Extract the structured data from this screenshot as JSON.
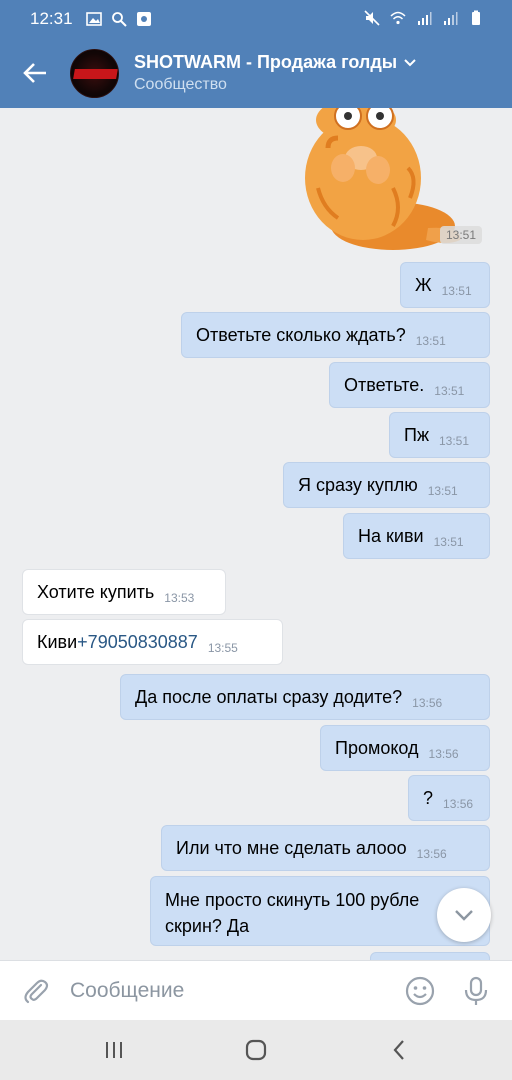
{
  "status_bar": {
    "time": "12:31"
  },
  "header": {
    "title": "SHOTWARM - Продажа голды",
    "subtitle": "Сообщество",
    "avatar_logo_text": "SHOTWARM"
  },
  "sticker": {
    "time": "13:51",
    "description": "cat-sticker"
  },
  "messages": [
    {
      "dir": "out",
      "text": "Ж",
      "time": "13:51"
    },
    {
      "dir": "out",
      "text": "Ответьте сколько ждать?",
      "time": "13:51"
    },
    {
      "dir": "out",
      "text": "Ответьте.",
      "time": "13:51"
    },
    {
      "dir": "out",
      "text": "Пж",
      "time": "13:51"
    },
    {
      "dir": "out",
      "text": "Я сразу куплю",
      "time": "13:51"
    },
    {
      "dir": "out",
      "text": "На киви",
      "time": "13:51"
    },
    {
      "dir": "in",
      "text": "Хотите купить",
      "time": "13:53"
    },
    {
      "dir": "in",
      "text": "Киви ",
      "link": "+79050830887",
      "time": "13:55"
    },
    {
      "dir": "out",
      "text": "Да после оплаты сразу додите?",
      "time": "13:56"
    },
    {
      "dir": "out",
      "text": "Промокод",
      "time": "13:56"
    },
    {
      "dir": "out",
      "text": "?",
      "time": "13:56"
    },
    {
      "dir": "out",
      "text": "Или что мне сделать алооо",
      "time": "13:56"
    },
    {
      "dir": "out",
      "text_line1": "Мне просто скинуть 100 рубле",
      "text_line2": "скрин?  Да",
      "time": "13:56"
    }
  ],
  "compose": {
    "placeholder": "Сообщение"
  },
  "colors": {
    "header": "#5181b8",
    "outgoing": "#ccdef5",
    "incoming": "#ffffff",
    "link": "#2a5885"
  }
}
